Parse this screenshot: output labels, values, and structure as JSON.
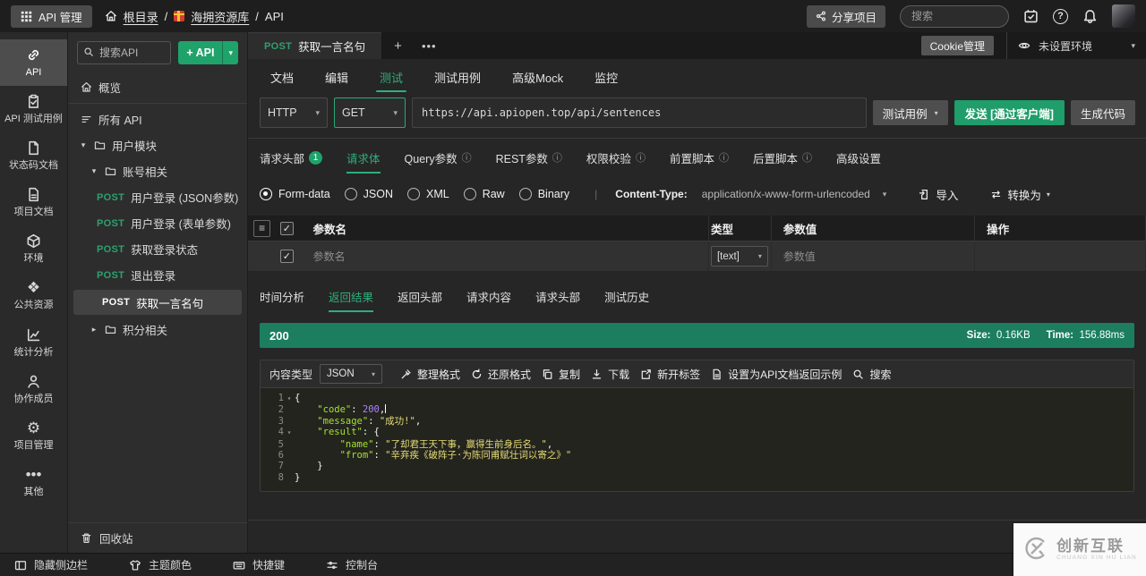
{
  "topbar": {
    "app_button": "API 管理",
    "breadcrumb": {
      "root": "根目录",
      "separator": "/",
      "project": "海拥资源库",
      "current": "API"
    },
    "share_button": "分享项目",
    "search_placeholder": "搜索"
  },
  "left_rail": {
    "items": [
      {
        "name": "api",
        "icon": "link",
        "label": "API",
        "active": true
      },
      {
        "name": "api-test-cases",
        "icon": "clipboard",
        "label": "API 测试用例"
      },
      {
        "name": "status-code-doc",
        "icon": "file",
        "label": "状态码文档"
      },
      {
        "name": "project-doc",
        "icon": "file2",
        "label": "项目文档"
      },
      {
        "name": "environment",
        "icon": "cube",
        "label": "环境"
      },
      {
        "name": "public-resources",
        "icon": "puzzle",
        "label": "公共资源"
      },
      {
        "name": "statistics",
        "icon": "stats",
        "label": "统计分析"
      },
      {
        "name": "members",
        "icon": "person",
        "label": "协作成员"
      },
      {
        "name": "project-admin",
        "icon": "gear",
        "label": "项目管理"
      },
      {
        "name": "other",
        "icon": "more",
        "label": "其他"
      }
    ]
  },
  "tree": {
    "search_placeholder": "搜索API",
    "add_button": "+ API",
    "items": [
      {
        "kind": "link",
        "name": "overview",
        "icon": "home",
        "label": "概览",
        "divider": true
      },
      {
        "kind": "link",
        "name": "all-api",
        "icon": "list",
        "label": "所有 API"
      },
      {
        "kind": "folder",
        "name": "folder-user-module",
        "indent": 0,
        "expanded": true,
        "label": "用户模块"
      },
      {
        "kind": "folder",
        "name": "folder-account",
        "indent": 1,
        "expanded": true,
        "label": "账号相关"
      },
      {
        "kind": "api",
        "name": "api-login-json",
        "method": "POST",
        "label": "用户登录 (JSON参数)"
      },
      {
        "kind": "api",
        "name": "api-login-form",
        "method": "POST",
        "label": "用户登录 (表单参数)"
      },
      {
        "kind": "api",
        "name": "api-login-status",
        "method": "POST",
        "label": "获取登录状态"
      },
      {
        "kind": "api",
        "name": "api-logout",
        "method": "POST",
        "label": "退出登录"
      },
      {
        "kind": "api",
        "name": "api-sentence",
        "method": "POST",
        "label": "获取一言名句",
        "active": true
      },
      {
        "kind": "folder",
        "name": "folder-points",
        "indent": 1,
        "expanded": false,
        "label": "积分相关"
      }
    ],
    "recycle_bin": "回收站"
  },
  "main": {
    "doc_tab": {
      "method": "POST",
      "title": "获取一言名句"
    },
    "cookie_button": "Cookie管理",
    "env": {
      "label": "未设置环境"
    },
    "nav_tabs": [
      {
        "label": "文档"
      },
      {
        "label": "编辑"
      },
      {
        "label": "测试",
        "active": true
      },
      {
        "label": "测试用例"
      },
      {
        "label": "高级Mock"
      },
      {
        "label": "监控"
      }
    ],
    "request": {
      "protocol": "HTTP",
      "method": "GET",
      "url": "https://api.apiopen.top/api/sentences",
      "case_button": "测试用例",
      "send_button": "发送 [通过客户端]",
      "codegen_button": "生成代码"
    },
    "req_tabs": [
      {
        "label": "请求头部",
        "badge": "1"
      },
      {
        "label": "请求体",
        "active": true
      },
      {
        "label": "Query参数",
        "info": true
      },
      {
        "label": "REST参数",
        "info": true
      },
      {
        "label": "权限校验",
        "info": true
      },
      {
        "label": "前置脚本",
        "info": true
      },
      {
        "label": "后置脚本",
        "info": true
      },
      {
        "label": "高级设置"
      }
    ],
    "body_types": [
      {
        "label": "Form-data",
        "selected": true
      },
      {
        "label": "JSON"
      },
      {
        "label": "XML"
      },
      {
        "label": "Raw"
      },
      {
        "label": "Binary"
      }
    ],
    "content_type": {
      "label": "Content-Type:",
      "value": "application/x-www-form-urlencoded"
    },
    "import_button": "导入",
    "convert_button": "转换为",
    "params_table": {
      "headers": {
        "name": "参数名",
        "type": "类型",
        "value": "参数值",
        "action": "操作"
      },
      "row": {
        "name_placeholder": "参数名",
        "type": "[text]",
        "value_placeholder": "参数值"
      }
    },
    "resp_tabs": [
      {
        "label": "时间分析"
      },
      {
        "label": "返回结果",
        "active": true
      },
      {
        "label": "返回头部"
      },
      {
        "label": "请求内容"
      },
      {
        "label": "请求头部"
      },
      {
        "label": "测试历史"
      }
    ],
    "status": {
      "code": "200",
      "size_label": "Size:",
      "size": "0.16KB",
      "time_label": "Time:",
      "time": "156.88ms"
    },
    "resp_toolbar": {
      "content_type_label": "内容类型",
      "format": "JSON",
      "actions": [
        {
          "name": "format-pretty",
          "icon": "wand",
          "label": "整理格式"
        },
        {
          "name": "format-raw",
          "icon": "restore",
          "label": "还原格式"
        },
        {
          "name": "copy",
          "icon": "copy",
          "label": "复制"
        },
        {
          "name": "download",
          "icon": "download",
          "label": "下载"
        },
        {
          "name": "new-tab",
          "icon": "newtab",
          "label": "新开标签"
        },
        {
          "name": "set-doc-example",
          "icon": "docset",
          "label": "设置为API文档返回示例"
        },
        {
          "name": "search",
          "icon": "search",
          "label": "搜索"
        }
      ]
    },
    "code": {
      "lines": [
        {
          "num": "1",
          "fold": true,
          "tokens": [
            [
              "pun",
              "{"
            ]
          ]
        },
        {
          "num": "2",
          "caret": true,
          "tokens": [
            [
              "pun",
              "    "
            ],
            [
              "key",
              "\"code\""
            ],
            [
              "pun",
              ": "
            ],
            [
              "num",
              "200"
            ],
            [
              "pun",
              ","
            ]
          ]
        },
        {
          "num": "3",
          "tokens": [
            [
              "pun",
              "    "
            ],
            [
              "key",
              "\"message\""
            ],
            [
              "pun",
              ": "
            ],
            [
              "str",
              "\"成功!\""
            ],
            [
              "pun",
              ","
            ]
          ]
        },
        {
          "num": "4",
          "fold": true,
          "tokens": [
            [
              "pun",
              "    "
            ],
            [
              "key",
              "\"result\""
            ],
            [
              "pun",
              ": "
            ],
            [
              "pun",
              "{"
            ]
          ]
        },
        {
          "num": "5",
          "tokens": [
            [
              "pun",
              "        "
            ],
            [
              "key",
              "\"name\""
            ],
            [
              "pun",
              ": "
            ],
            [
              "str",
              "\"了却君王天下事，赢得生前身后名。\""
            ],
            [
              "pun",
              ","
            ]
          ]
        },
        {
          "num": "6",
          "tokens": [
            [
              "pun",
              "        "
            ],
            [
              "key",
              "\"from\""
            ],
            [
              "pun",
              ": "
            ],
            [
              "str",
              "\"辛弃疾《破阵子·为陈同甫赋壮词以寄之》\""
            ]
          ]
        },
        {
          "num": "7",
          "tokens": [
            [
              "pun",
              "    "
            ],
            [
              "pun",
              "}"
            ]
          ]
        },
        {
          "num": "8",
          "tokens": [
            [
              "pun",
              "}"
            ]
          ]
        }
      ]
    }
  },
  "bottom_bar": {
    "items": [
      {
        "name": "hide-sidebar",
        "icon": "sidebar",
        "label": "隐藏侧边栏"
      },
      {
        "name": "theme-color",
        "icon": "shirt",
        "label": "主题颜色"
      },
      {
        "name": "shortcuts",
        "icon": "keyboard",
        "label": "快捷键"
      },
      {
        "name": "console",
        "icon": "consoleic",
        "label": "控制台"
      }
    ]
  },
  "watermark": {
    "title": "创新互联",
    "subtitle": "CHUANG XIN HU LIAN"
  },
  "colors": {
    "accent": "#2fae7c",
    "send_green": "#1f9d6a",
    "status_green": "#1c7e5f",
    "post_green": "#2ea06e"
  }
}
